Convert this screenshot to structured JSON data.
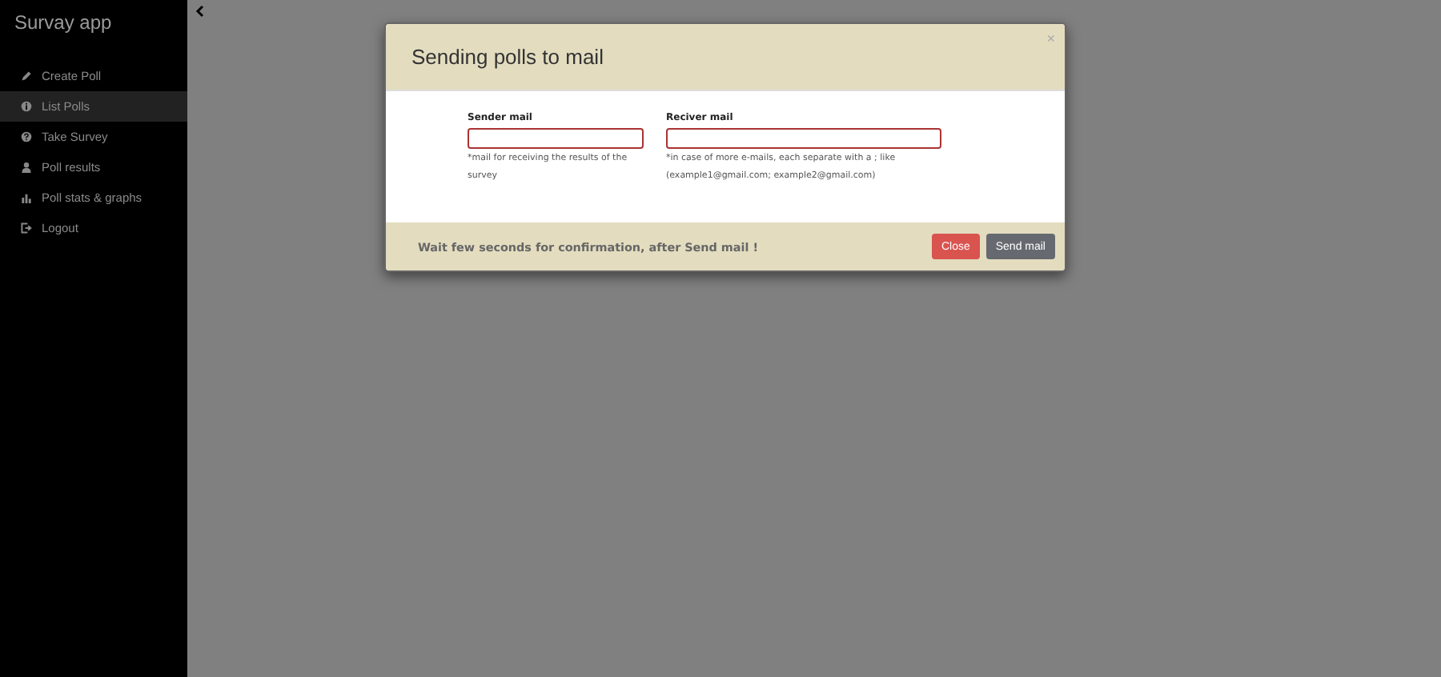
{
  "sidebar": {
    "title": "Survay app",
    "items": [
      {
        "label": "Create Poll",
        "selected": false
      },
      {
        "label": "List Polls",
        "selected": true
      },
      {
        "label": "Take Survey",
        "selected": false
      },
      {
        "label": "Poll results",
        "selected": false
      },
      {
        "label": "Poll stats & graphs",
        "selected": false
      },
      {
        "label": "Logout",
        "selected": false
      }
    ]
  },
  "dialog": {
    "title": "Sending polls to mail",
    "close_glyph": "×",
    "fields": [
      {
        "label": "Sender mail",
        "hint": "*mail for receiving the results of the survey"
      },
      {
        "label": "Reciver mail",
        "hint": "*in case of more e-mails, each separate with a ; like (example1@gmail.com; example2@gmail.com)"
      }
    ],
    "footer_note": "Wait few seconds for confirmation, after Send mail !",
    "buttons": [
      {
        "label": "Close",
        "kind": "danger"
      },
      {
        "label": "Send mail",
        "kind": "secondary"
      }
    ]
  }
}
